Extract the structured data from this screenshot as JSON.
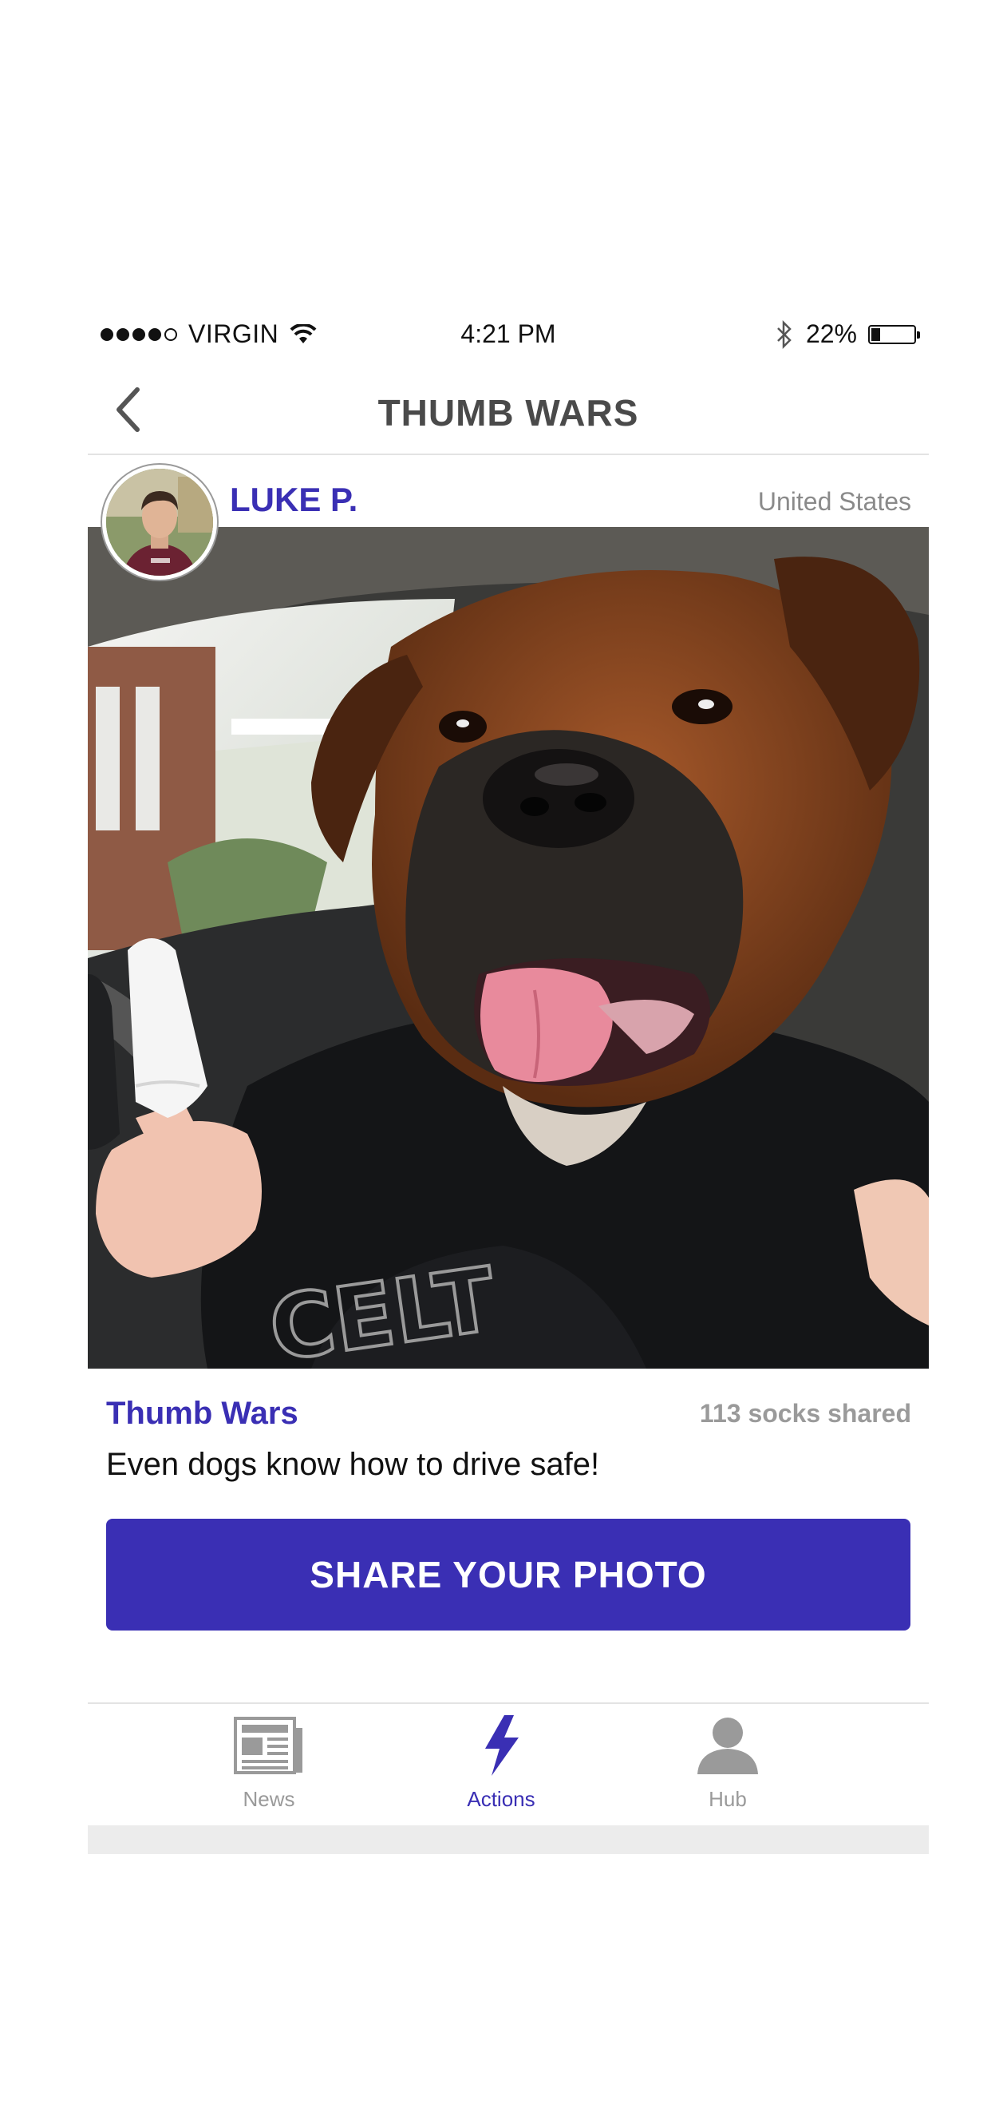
{
  "status_bar": {
    "carrier": "VIRGIN",
    "time": "4:21 PM",
    "battery_percent": "22%",
    "battery_level": 0.22,
    "signal_bars_filled": 4,
    "signal_bars_total": 5
  },
  "nav": {
    "title": "THUMB WARS",
    "back_icon": "chevron-left-icon"
  },
  "post": {
    "user_name": "LUKE P.",
    "country": "United States",
    "action_title": "Thumb Wars",
    "share_count": "113 socks shared",
    "caption": "Even dogs know how to drive safe!",
    "share_button_label": "SHARE YOUR PHOTO"
  },
  "tabs": [
    {
      "label": "News",
      "icon": "newspaper-icon",
      "active": false
    },
    {
      "label": "Actions",
      "icon": "lightning-icon",
      "active": true
    },
    {
      "label": "Hub",
      "icon": "person-icon",
      "active": false
    }
  ],
  "colors": {
    "accent": "#3a2fb4",
    "inactive": "#9a9a9a",
    "title": "#4a4a4a"
  }
}
